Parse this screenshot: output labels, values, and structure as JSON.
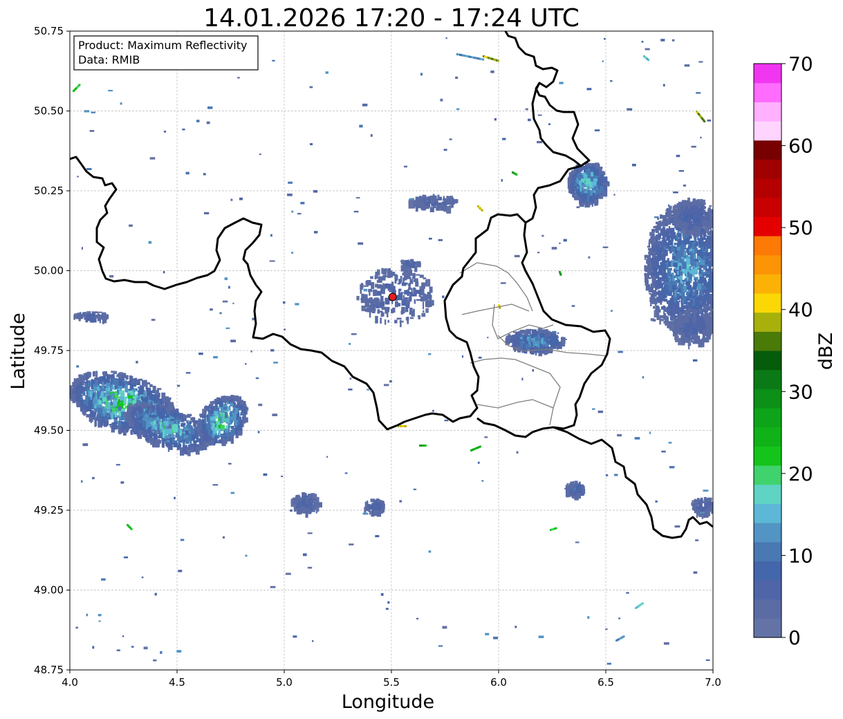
{
  "title": "14.01.2026 17:20 - 17:24 UTC",
  "info_box": {
    "product": "Product: Maximum Reflectivity",
    "data": "Data: RMIB"
  },
  "axes": {
    "xlabel": "Longitude",
    "ylabel": "Latitude",
    "xlim": [
      4.0,
      7.0
    ],
    "ylim": [
      48.75,
      50.75
    ],
    "xticks": [
      "4.0",
      "4.5",
      "5.0",
      "5.5",
      "6.0",
      "6.5",
      "7.0"
    ],
    "yticks": [
      "48.75",
      "49.00",
      "49.25",
      "49.50",
      "49.75",
      "50.00",
      "50.25",
      "50.50",
      "50.75"
    ],
    "grid": true
  },
  "colorbar": {
    "label": "dBZ",
    "min": 0,
    "max": 70,
    "ticks": [
      "0",
      "10",
      "20",
      "30",
      "40",
      "50",
      "60",
      "70"
    ],
    "colors": [
      "#6373a5",
      "#5b6ca5",
      "#4f65a7",
      "#4466aa",
      "#4a78b3",
      "#5294c3",
      "#5cb8d6",
      "#60d4c4",
      "#40d26d",
      "#14c41a",
      "#10b218",
      "#0da41a",
      "#0c9018",
      "#0b7a16",
      "#055c0a",
      "#4a7a08",
      "#a8b00c",
      "#fad705",
      "#fbb105",
      "#fc9405",
      "#fc7a05",
      "#e50000",
      "#c90000",
      "#b50000",
      "#a00000",
      "#780000",
      "#ffd4ff",
      "#ffb0ff",
      "#ff6cff",
      "#f036f0"
    ]
  },
  "chart_data": {
    "type": "heatmap",
    "title": "14.01.2026 17:20 - 17:24 UTC",
    "xlabel": "Longitude",
    "ylabel": "Latitude",
    "xlim": [
      4.0,
      7.0
    ],
    "ylim": [
      48.75,
      50.75
    ],
    "variable": "dBZ",
    "range": [
      0,
      70
    ],
    "radar_site": {
      "lon": 5.505,
      "lat": 49.914
    },
    "echo_regions": [
      {
        "name": "west",
        "lon": [
          4.0,
          4.85
        ],
        "lat": [
          49.44,
          49.7
        ],
        "max_dbz": 28
      },
      {
        "name": "east",
        "lon": [
          6.75,
          7.0
        ],
        "lat": [
          49.75,
          50.25
        ],
        "max_dbz": 18
      },
      {
        "name": "north-east",
        "lon": [
          6.3,
          6.55
        ],
        "lat": [
          50.15,
          50.35
        ],
        "max_dbz": 25
      },
      {
        "name": "luxembourg",
        "lon": [
          6.05,
          6.35
        ],
        "lat": [
          49.7,
          49.85
        ],
        "max_dbz": 20
      },
      {
        "name": "south",
        "lon": [
          5.05,
          5.5
        ],
        "lat": [
          49.2,
          49.35
        ],
        "max_dbz": 15
      }
    ]
  }
}
